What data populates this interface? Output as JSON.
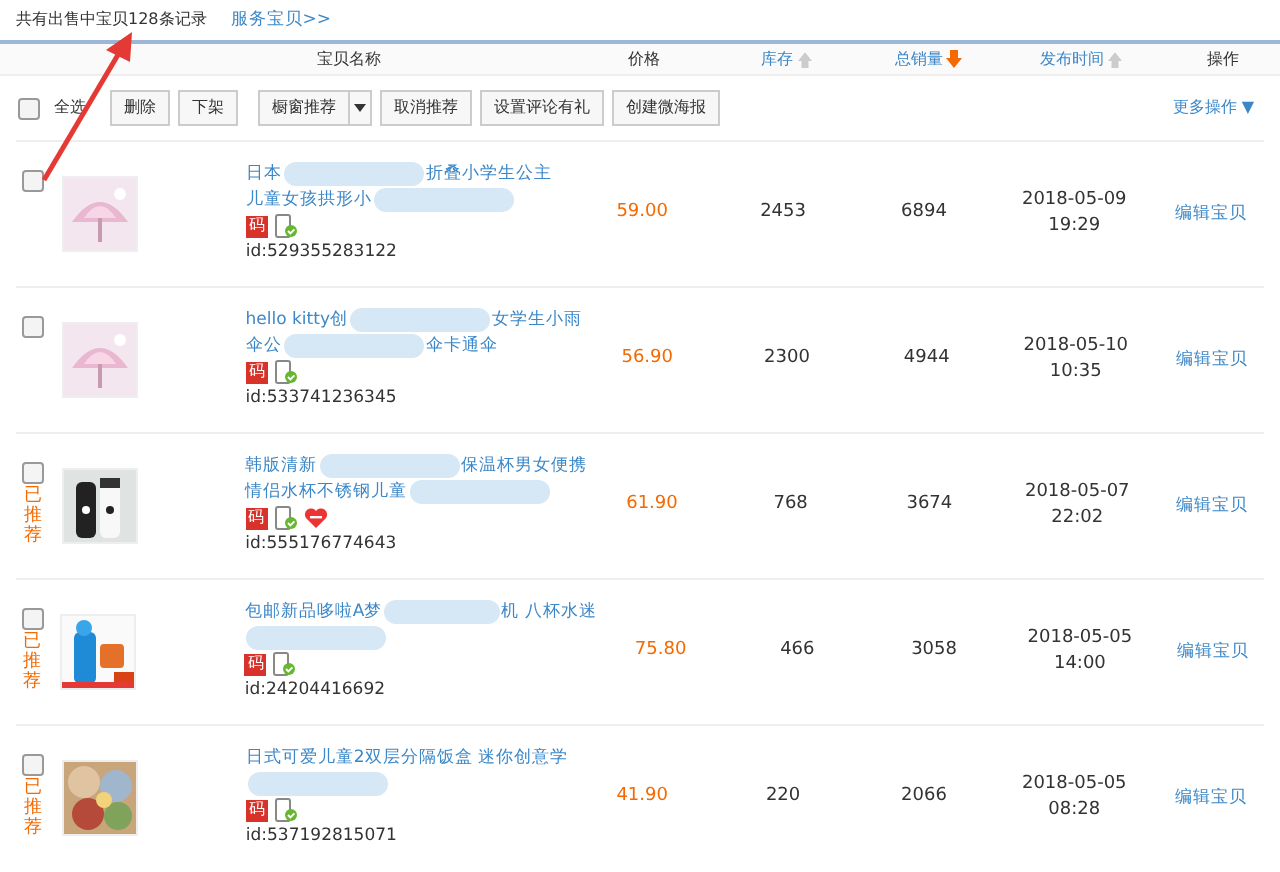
{
  "summary": {
    "text": "共有出售中宝贝128条记录",
    "link": "服务宝贝>>"
  },
  "columns": [
    {
      "label": "宝贝名称",
      "kind": "plain"
    },
    {
      "label": "价格",
      "kind": "plain"
    },
    {
      "label": "库存",
      "kind": "sortable",
      "selected": false
    },
    {
      "label": "总销量",
      "kind": "sortable",
      "selected": true
    },
    {
      "label": "发布时间",
      "kind": "sortable",
      "selected": false
    },
    {
      "label": "操作",
      "kind": "plain"
    }
  ],
  "toolbar": {
    "select_all": {
      "label": "全选",
      "checked": false
    },
    "buttons": [
      {
        "label": "删除",
        "kind": "plain"
      },
      {
        "label": "下架",
        "kind": "plain"
      },
      {
        "label": "橱窗推荐",
        "kind": "dropdown"
      },
      {
        "label": "取消推荐",
        "kind": "plain"
      },
      {
        "label": "设置评论有礼",
        "kind": "plain"
      },
      {
        "label": "创建微海报",
        "kind": "plain"
      }
    ],
    "more": "更多操作 ▼"
  },
  "rows": [
    {
      "checked": false,
      "title_lines": [
        {
          "parts": [
            "日本",
            "折叠小学生公主"
          ]
        },
        {
          "parts": [
            "儿童女孩拱形小"
          ],
          "tail_blurred": true
        }
      ],
      "badges": [
        {
          "kind": "code",
          "text": "码"
        },
        {
          "kind": "mobile"
        }
      ],
      "id": "id:529355283122",
      "price": "59.00",
      "stock": "2453",
      "sales": "6894",
      "date": "2018-05-09",
      "time": "19:29",
      "action": "编辑宝贝"
    },
    {
      "checked": false,
      "title_lines": [
        {
          "parts": [
            "hello kitty创",
            "女学生小雨"
          ]
        },
        {
          "parts": [
            "伞公",
            "伞卡通伞"
          ]
        }
      ],
      "badges": [
        {
          "kind": "code",
          "text": "码"
        },
        {
          "kind": "mobile"
        }
      ],
      "id": "id:533741236345",
      "price": "56.90",
      "stock": "2300",
      "sales": "4944",
      "date": "2018-05-10",
      "time": "10:35",
      "action": "编辑宝贝"
    },
    {
      "checked": false,
      "recommended": "已推荐",
      "title_lines": [
        {
          "parts": [
            "韩版清新",
            "保温杯男女便携"
          ]
        },
        {
          "parts": [
            "情侣水杯不锈钢儿童"
          ],
          "tail_blurred": true
        }
      ],
      "badges": [
        {
          "kind": "code",
          "text": "码"
        },
        {
          "kind": "mobile"
        },
        {
          "kind": "heart"
        }
      ],
      "id": "id:555176774643",
      "price": "61.90",
      "stock": "768",
      "sales": "3674",
      "date": "2018-05-07",
      "time": "22:02",
      "action": "编辑宝贝"
    },
    {
      "checked": false,
      "recommended": "已推荐",
      "title_lines": [
        {
          "parts": [
            "包邮新品哆啦A梦",
            "机 八杯水迷"
          ]
        },
        {
          "tail_blurred": true
        }
      ],
      "badges": [
        {
          "kind": "code",
          "text": "码"
        },
        {
          "kind": "mobile"
        }
      ],
      "id": "id:24204416692",
      "price": "75.80",
      "stock": "466",
      "sales": "3058",
      "date": "2018-05-05",
      "time": "14:00",
      "action": "编辑宝贝"
    },
    {
      "checked": false,
      "recommended": "已推荐",
      "title_lines": [
        {
          "parts": [
            "日式可爱儿童2双层分隔饭盒 迷你创意学"
          ]
        },
        {
          "tail_blurred": true
        }
      ],
      "badges": [
        {
          "kind": "code",
          "text": "码"
        },
        {
          "kind": "mobile"
        }
      ],
      "id": "id:537192815071",
      "price": "41.90",
      "stock": "220",
      "sales": "2066",
      "date": "2018-05-05",
      "time": "08:28",
      "action": "编辑宝贝"
    }
  ]
}
